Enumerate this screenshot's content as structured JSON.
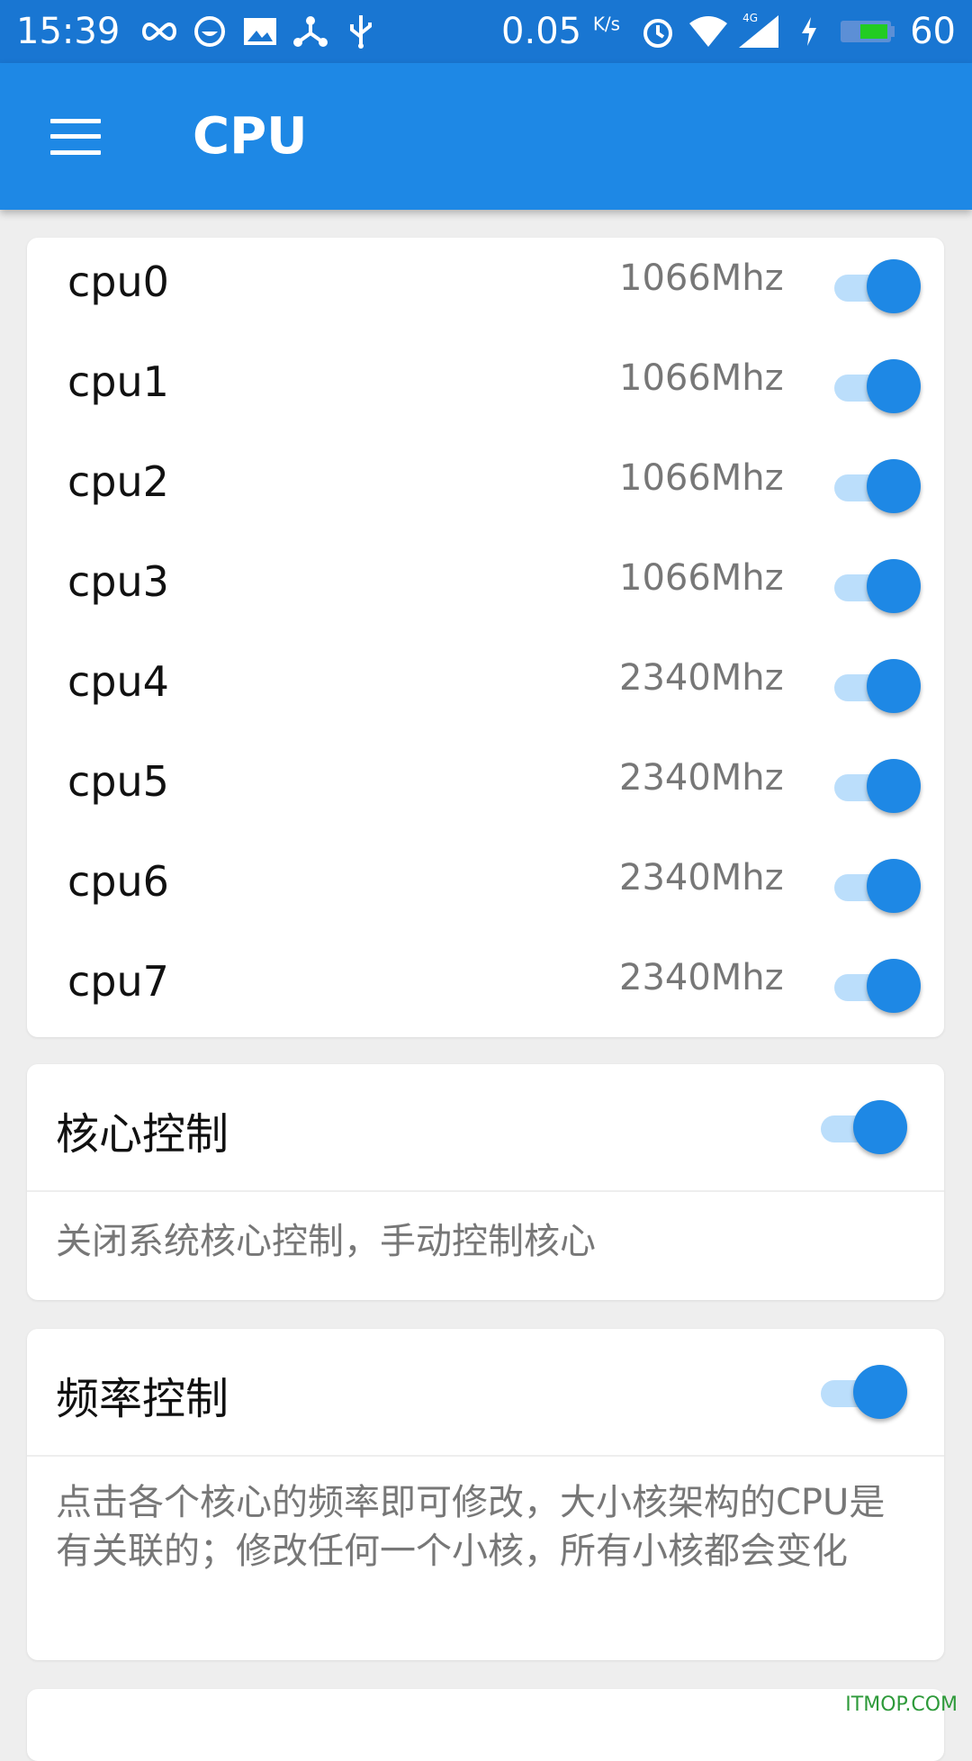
{
  "status_bar": {
    "time": "15:39",
    "speed_value": "0.05",
    "speed_unit": "K/s",
    "network": "4G",
    "battery": "60"
  },
  "app_bar": {
    "title": "CPU"
  },
  "cpu_list": [
    {
      "name": "cpu0",
      "freq": "1066Mhz",
      "enabled": true
    },
    {
      "name": "cpu1",
      "freq": "1066Mhz",
      "enabled": true
    },
    {
      "name": "cpu2",
      "freq": "1066Mhz",
      "enabled": true
    },
    {
      "name": "cpu3",
      "freq": "1066Mhz",
      "enabled": true
    },
    {
      "name": "cpu4",
      "freq": "2340Mhz",
      "enabled": true
    },
    {
      "name": "cpu5",
      "freq": "2340Mhz",
      "enabled": true
    },
    {
      "name": "cpu6",
      "freq": "2340Mhz",
      "enabled": true
    },
    {
      "name": "cpu7",
      "freq": "2340Mhz",
      "enabled": true
    }
  ],
  "core_control": {
    "title": "核心控制",
    "enabled": true,
    "description": "关闭系统核心控制，手动控制核心"
  },
  "freq_control": {
    "title": "频率控制",
    "enabled": true,
    "description": "点击各个核心的频率即可修改，大小核架构的CPU是有关联的；修改任何一个小核，所有小核都会变化"
  },
  "watermark": "ITMOP.COM",
  "colors": {
    "status_bar": "#1976d2",
    "app_bar": "#1e88e5",
    "switch_thumb": "#1e88e5",
    "switch_track": "#bbdefb"
  }
}
